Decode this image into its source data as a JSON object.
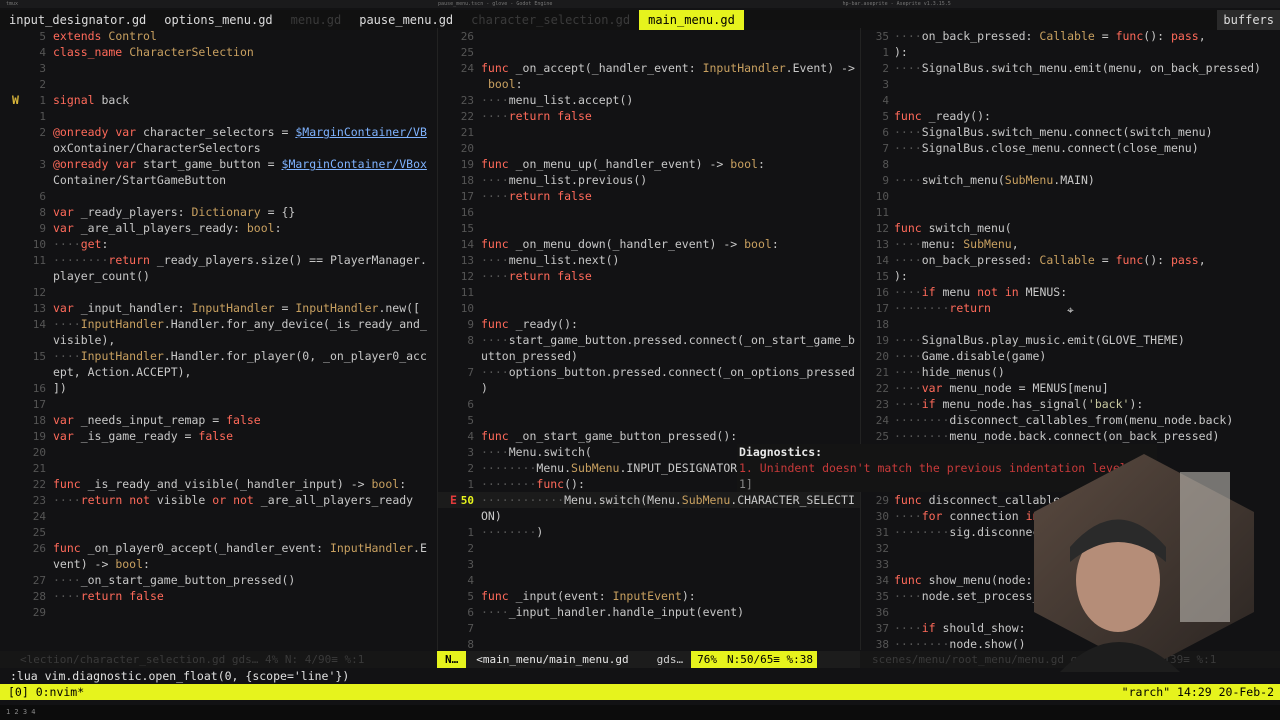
{
  "sysbar": {
    "left": "tmux",
    "center": "pause_menu.tscn - glove - Godot Engine",
    "right": "hp-bar.aseprite - Aseprite v1.3.15.5"
  },
  "buffers": {
    "tabs": [
      {
        "label": "input_designator.gd",
        "state": "active"
      },
      {
        "label": "options_menu.gd",
        "state": "active"
      },
      {
        "label": "menu.gd",
        "state": "inactive"
      },
      {
        "label": "pause_menu.gd",
        "state": "active"
      },
      {
        "label": "character_selection.gd",
        "state": "inactive"
      },
      {
        "label": "main_menu.gd",
        "state": "current"
      }
    ],
    "right_label": "buffers"
  },
  "left_pane": {
    "lines": [
      {
        "n": "5",
        "t": "extends Control"
      },
      {
        "n": "4",
        "t": "class_name CharacterSelection"
      },
      {
        "n": "3",
        "t": ""
      },
      {
        "n": "2",
        "t": ""
      },
      {
        "n": "1",
        "t": "signal back",
        "sign": "W"
      },
      {
        "n": "1",
        "t": ""
      },
      {
        "n": "2",
        "t": "@onready var character_selectors = $MarginContainer/VB"
      },
      {
        "n": "",
        "t": "oxContainer/CharacterSelectors"
      },
      {
        "n": "3",
        "t": "@onready var start_game_button = $MarginContainer/VBox"
      },
      {
        "n": "",
        "t": "Container/StartGameButton"
      },
      {
        "n": "6",
        "t": ""
      },
      {
        "n": "8",
        "t": "var _ready_players: Dictionary = {}"
      },
      {
        "n": "9",
        "t": "var _are_all_players_ready: bool:"
      },
      {
        "n": "10",
        "t": "····get:"
      },
      {
        "n": "11",
        "t": "········return _ready_players.size() == PlayerManager."
      },
      {
        "n": "",
        "t": "player_count()"
      },
      {
        "n": "12",
        "t": ""
      },
      {
        "n": "13",
        "t": "var _input_handler: InputHandler = InputHandler.new(["
      },
      {
        "n": "14",
        "t": "····InputHandler.Handler.for_any_device(_is_ready_and_"
      },
      {
        "n": "",
        "t": "visible),"
      },
      {
        "n": "15",
        "t": "····InputHandler.Handler.for_player(0, _on_player0_acc"
      },
      {
        "n": "",
        "t": "ept, Action.ACCEPT),"
      },
      {
        "n": "16",
        "t": "])"
      },
      {
        "n": "17",
        "t": ""
      },
      {
        "n": "18",
        "t": "var _needs_input_remap = false"
      },
      {
        "n": "19",
        "t": "var _is_game_ready = false"
      },
      {
        "n": "20",
        "t": ""
      },
      {
        "n": "21",
        "t": ""
      },
      {
        "n": "22",
        "t": "func _is_ready_and_visible(_handler_input) -> bool:"
      },
      {
        "n": "23",
        "t": "····return not visible or not _are_all_players_ready"
      },
      {
        "n": "24",
        "t": ""
      },
      {
        "n": "25",
        "t": ""
      },
      {
        "n": "26",
        "t": "func _on_player0_accept(_handler_event: InputHandler.E"
      },
      {
        "n": "",
        "t": "vent) -> bool:"
      },
      {
        "n": "27",
        "t": "····_on_start_game_button_pressed()"
      },
      {
        "n": "28",
        "t": "····return false"
      },
      {
        "n": "29",
        "t": ""
      }
    ]
  },
  "mid_pane": {
    "lines": [
      {
        "n": "26",
        "t": ""
      },
      {
        "n": "25",
        "t": ""
      },
      {
        "n": "24",
        "t": "func _on_accept(_handler_event: InputHandler.Event) ->"
      },
      {
        "n": "",
        "t": " bool:"
      },
      {
        "n": "23",
        "t": "····menu_list.accept()"
      },
      {
        "n": "22",
        "t": "····return false"
      },
      {
        "n": "21",
        "t": ""
      },
      {
        "n": "20",
        "t": ""
      },
      {
        "n": "19",
        "t": "func _on_menu_up(_handler_event) -> bool:"
      },
      {
        "n": "18",
        "t": "····menu_list.previous()"
      },
      {
        "n": "17",
        "t": "····return false"
      },
      {
        "n": "16",
        "t": ""
      },
      {
        "n": "15",
        "t": ""
      },
      {
        "n": "14",
        "t": "func _on_menu_down(_handler_event) -> bool:"
      },
      {
        "n": "13",
        "t": "····menu_list.next()"
      },
      {
        "n": "12",
        "t": "····return false"
      },
      {
        "n": "11",
        "t": ""
      },
      {
        "n": "10",
        "t": ""
      },
      {
        "n": "9",
        "t": "func _ready():"
      },
      {
        "n": "8",
        "t": "····start_game_button.pressed.connect(_on_start_game_b"
      },
      {
        "n": "",
        "t": "utton_pressed)"
      },
      {
        "n": "7",
        "t": "····options_button.pressed.connect(_on_options_pressed"
      },
      {
        "n": "",
        "t": ")"
      },
      {
        "n": "6",
        "t": ""
      },
      {
        "n": "5",
        "t": ""
      },
      {
        "n": "4",
        "t": "func _on_start_game_button_pressed():"
      },
      {
        "n": "3",
        "t": "····Menu.switch("
      },
      {
        "n": "2",
        "t": "········Menu.SubMenu.INPUT_DESIGNATOR,"
      },
      {
        "n": "1",
        "t": "········func():"
      },
      {
        "n": "50",
        "t": "············Menu.switch(Menu.SubMenu.CHARACTER_SELECTI",
        "sign": "E",
        "cursor": true
      },
      {
        "n": "",
        "t": "ON)"
      },
      {
        "n": "1",
        "t": "········)"
      },
      {
        "n": "2",
        "t": ""
      },
      {
        "n": "3",
        "t": ""
      },
      {
        "n": "4",
        "t": ""
      },
      {
        "n": "5",
        "t": "func _input(event: InputEvent):"
      },
      {
        "n": "6",
        "t": "····_input_handler.handle_input(event)"
      },
      {
        "n": "7",
        "t": ""
      },
      {
        "n": "8",
        "t": ""
      }
    ]
  },
  "right_pane": {
    "lines": [
      {
        "n": "35",
        "t": "····on_back_pressed: Callable = func(): pass,"
      },
      {
        "n": "1",
        "t": "):"
      },
      {
        "n": "2",
        "t": "····SignalBus.switch_menu.emit(menu, on_back_pressed)"
      },
      {
        "n": "3",
        "t": ""
      },
      {
        "n": "4",
        "t": ""
      },
      {
        "n": "5",
        "t": "func _ready():"
      },
      {
        "n": "6",
        "t": "····SignalBus.switch_menu.connect(switch_menu)"
      },
      {
        "n": "7",
        "t": "····SignalBus.close_menu.connect(close_menu)"
      },
      {
        "n": "8",
        "t": ""
      },
      {
        "n": "9",
        "t": "····switch_menu(SubMenu.MAIN)"
      },
      {
        "n": "10",
        "t": ""
      },
      {
        "n": "11",
        "t": ""
      },
      {
        "n": "12",
        "t": "func switch_menu("
      },
      {
        "n": "13",
        "t": "····menu: SubMenu,"
      },
      {
        "n": "14",
        "t": "····on_back_pressed: Callable = func(): pass,"
      },
      {
        "n": "15",
        "t": "):"
      },
      {
        "n": "16",
        "t": "····if menu not in MENUS:"
      },
      {
        "n": "17",
        "t": "········return"
      },
      {
        "n": "18",
        "t": ""
      },
      {
        "n": "19",
        "t": "····SignalBus.play_music.emit(GLOVE_THEME)"
      },
      {
        "n": "20",
        "t": "····Game.disable(game)"
      },
      {
        "n": "21",
        "t": "····hide_menus()"
      },
      {
        "n": "22",
        "t": "····var menu_node = MENUS[menu]"
      },
      {
        "n": "23",
        "t": "····if menu_node.has_signal('back'):"
      },
      {
        "n": "24",
        "t": "········disconnect_callables_from(menu_node.back)"
      },
      {
        "n": "25",
        "t": "········menu_node.back.connect(on_back_pressed)"
      },
      {
        "n": "26",
        "t": ""
      },
      {
        "n": "27",
        "t": ""
      },
      {
        "n": "28",
        "t": ""
      },
      {
        "n": "29",
        "t": "func disconnect_callables_from("
      },
      {
        "n": "30",
        "t": "····for connection in sig."
      },
      {
        "n": "31",
        "t": "········sig.disconnect(c"
      },
      {
        "n": "32",
        "t": ""
      },
      {
        "n": "33",
        "t": ""
      },
      {
        "n": "34",
        "t": "func show_menu(node: N"
      },
      {
        "n": "35",
        "t": "····node.set_process_inp"
      },
      {
        "n": "36",
        "t": ""
      },
      {
        "n": "37",
        "t": "····if should_show:"
      },
      {
        "n": "38",
        "t": "········node.show()"
      }
    ]
  },
  "diagnostics": {
    "title": "Diagnostics:",
    "message": "1. Unindent doesn't match the previous indentation level.",
    "suffix": "1]"
  },
  "status": {
    "left": "<lection/character_selection.gd   gds…   4%  N:  4/90≡ %:1",
    "mode": "N…",
    "file": "<main_menu/main_menu.gd",
    "filetype": "gds…",
    "percent": "76%",
    "position": "N:50/65≡ %:38",
    "right": "scenes/menu/root_menu/menu.gd   gds…   71%  N:35/139≡ %:1"
  },
  "cmdline": ":lua vim.diagnostic.open_float(0, {scope='line'})",
  "tmux": {
    "left": "[0] 0:nvim*",
    "right": "\"rarch\" 14:29 20-Feb-2"
  },
  "colors": {
    "accent": "#e6f31d",
    "error": "#e23b3b",
    "warning": "#d7b43a",
    "keyword": "#ff6a5a"
  }
}
